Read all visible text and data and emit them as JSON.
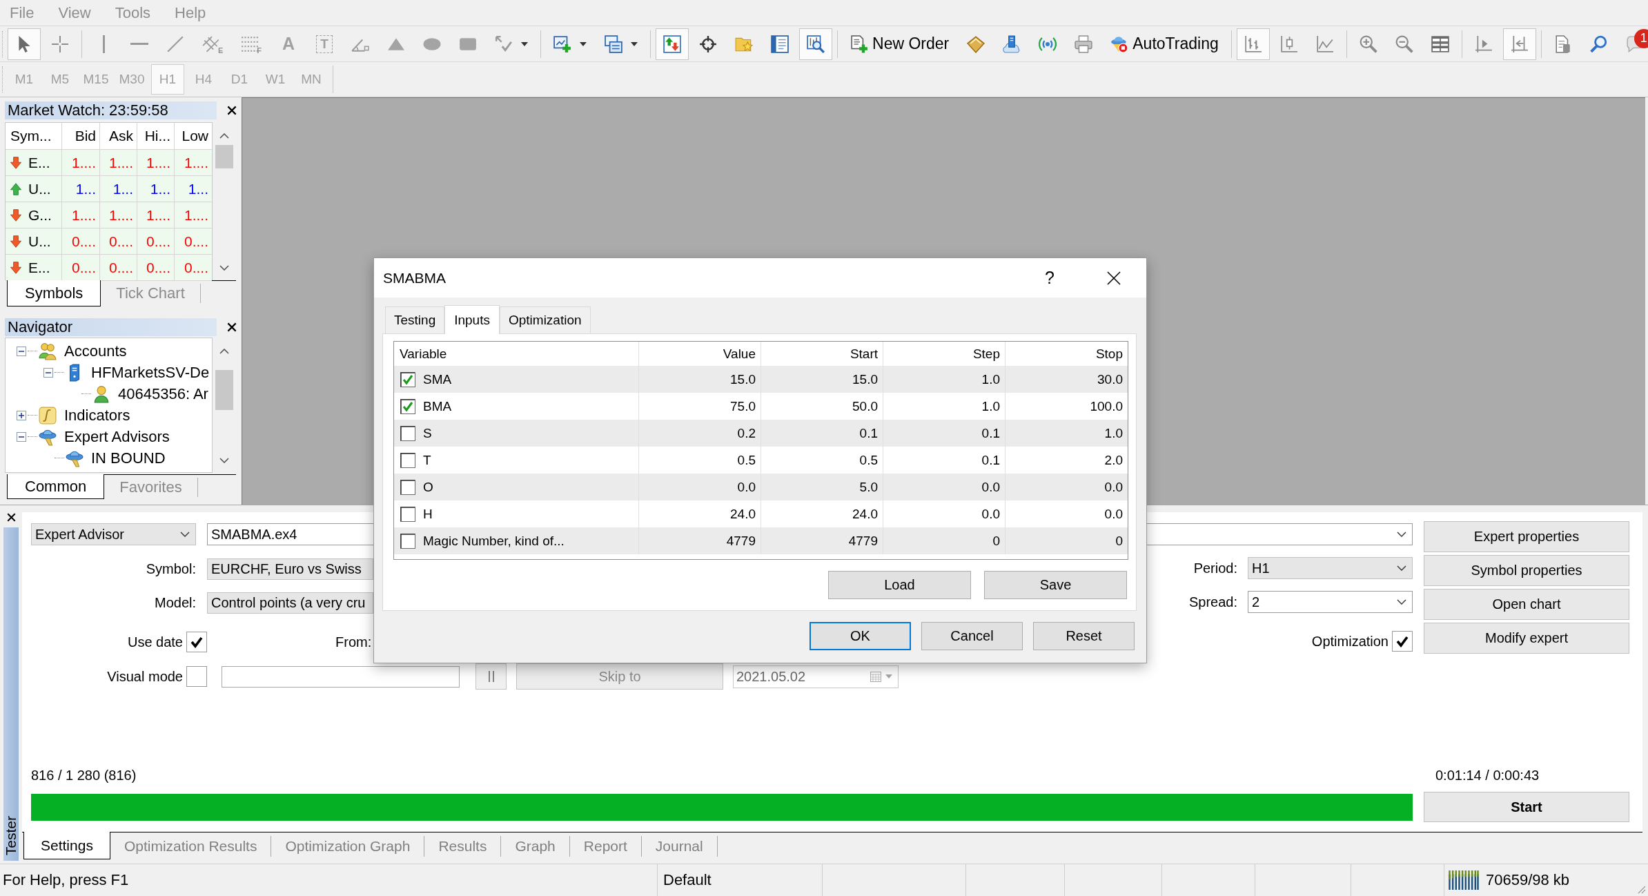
{
  "menu": [
    "File",
    "View",
    "Tools",
    "Help"
  ],
  "toolbar": {
    "groups": [
      [
        {
          "kind": "cursor",
          "pressed": true
        },
        {
          "kind": "crosshair",
          "pressed": false
        }
      ],
      [
        {
          "kind": "vertical-line",
          "pressed": false
        },
        {
          "kind": "horizontal-line",
          "pressed": false
        },
        {
          "kind": "trend-line",
          "pressed": false
        },
        {
          "kind": "channel",
          "glyph": "E",
          "pressed": false
        },
        {
          "kind": "fibonacci",
          "glyph": "F",
          "pressed": false
        },
        {
          "kind": "text",
          "glyph": "A",
          "pressed": false
        },
        {
          "kind": "label",
          "glyph": "T",
          "pressed": false
        },
        {
          "kind": "angle",
          "pressed": false
        },
        {
          "kind": "triangle",
          "pressed": false
        },
        {
          "kind": "ellipse",
          "pressed": false
        },
        {
          "kind": "rectangle",
          "pressed": false
        },
        {
          "kind": "arrows",
          "dropdown": true,
          "pressed": false
        }
      ],
      [
        {
          "kind": "new-chart",
          "dropdown": true,
          "pressed": false
        },
        {
          "kind": "profiles",
          "dropdown": true,
          "pressed": false
        }
      ],
      [
        {
          "kind": "market-watch",
          "pressed": true
        },
        {
          "kind": "data-window",
          "pressed": false
        },
        {
          "kind": "navigator",
          "pressed": false
        },
        {
          "kind": "terminal",
          "pressed": false
        },
        {
          "kind": "tester",
          "pressed": true
        }
      ],
      [
        {
          "kind": "new-order",
          "label": "New Order",
          "pressed": false
        },
        {
          "kind": "editor",
          "pressed": false
        },
        {
          "kind": "market",
          "pressed": false
        },
        {
          "kind": "signals",
          "pressed": false
        },
        {
          "kind": "print",
          "pressed": false
        },
        {
          "kind": "autotrading",
          "label": "AutoTrading",
          "pressed": false
        }
      ],
      [
        {
          "kind": "bar-chart",
          "pressed": true
        },
        {
          "kind": "candles",
          "pressed": false
        },
        {
          "kind": "line-chart",
          "pressed": false
        }
      ],
      [
        {
          "kind": "zoom-in",
          "pressed": false
        },
        {
          "kind": "zoom-out",
          "pressed": false
        },
        {
          "kind": "tile",
          "pressed": false
        }
      ],
      [
        {
          "kind": "chart-shift",
          "pressed": false
        },
        {
          "kind": "auto-scroll",
          "pressed": true
        }
      ],
      [
        {
          "kind": "templates",
          "pressed": false
        },
        {
          "kind": "search",
          "pressed": false
        },
        {
          "kind": "chat",
          "badge": "1",
          "pressed": false
        }
      ]
    ]
  },
  "timeframes": [
    {
      "label": "M1",
      "selected": false
    },
    {
      "label": "M5",
      "selected": false
    },
    {
      "label": "M15",
      "selected": false
    },
    {
      "label": "M30",
      "selected": false
    },
    {
      "label": "H1",
      "selected": true
    },
    {
      "label": "H4",
      "selected": false
    },
    {
      "label": "D1",
      "selected": false
    },
    {
      "label": "W1",
      "selected": false
    },
    {
      "label": "MN",
      "selected": false
    }
  ],
  "market_watch": {
    "title": "Market Watch: 23:59:58",
    "columns": [
      "Sym...",
      "Bid",
      "Ask",
      "Hi...",
      "Low"
    ],
    "rows": [
      {
        "kind": "down",
        "symbol": "E...",
        "bid": "1....",
        "ask": "1....",
        "high": "1....",
        "low": "1...."
      },
      {
        "kind": "up",
        "symbol": "U...",
        "bid": "1...",
        "ask": "1...",
        "high": "1...",
        "low": "1..."
      },
      {
        "kind": "down",
        "symbol": "G...",
        "bid": "1....",
        "ask": "1....",
        "high": "1....",
        "low": "1...."
      },
      {
        "kind": "down",
        "symbol": "U...",
        "bid": "0....",
        "ask": "0....",
        "high": "0....",
        "low": "0...."
      },
      {
        "kind": "down",
        "symbol": "E...",
        "bid": "0....",
        "ask": "0....",
        "high": "0....",
        "low": "0...."
      }
    ],
    "tabs": [
      {
        "label": "Symbols",
        "selected": true
      },
      {
        "label": "Tick Chart",
        "selected": false
      }
    ]
  },
  "navigator": {
    "title": "Navigator",
    "tree": [
      {
        "kind": "accounts",
        "label": "Accounts",
        "expanded": true,
        "children": [
          {
            "kind": "server",
            "label": "HFMarketsSV-De",
            "expanded": true,
            "children": [
              {
                "kind": "account",
                "label": "40645356: Ar"
              }
            ]
          }
        ]
      },
      {
        "kind": "indicators",
        "label": "Indicators",
        "expanded": false
      },
      {
        "kind": "experts",
        "label": "Expert Advisors",
        "expanded": true,
        "children": [
          {
            "kind": "expert",
            "label": "IN BOUND"
          }
        ]
      }
    ],
    "tabs": [
      {
        "label": "Common",
        "selected": true
      },
      {
        "label": "Favorites",
        "selected": false
      }
    ]
  },
  "tester": {
    "side_label": "Tester",
    "expert_type": {
      "kind": "list",
      "value": "Expert Advisor"
    },
    "expert_file": {
      "kind": "edit",
      "value": "SMABMA.ex4"
    },
    "fields": [
      {
        "label": "Symbol:",
        "kind": "list",
        "value": "EURCHF, Euro vs Swiss"
      },
      {
        "label": "Model:",
        "kind": "list",
        "value": "Control points (a very cru"
      }
    ],
    "use_date": {
      "label": "Use date",
      "checked": true
    },
    "from_label": "From:",
    "visual_mode": {
      "label": "Visual mode",
      "checked": false
    },
    "skip_to": {
      "label": "Skip to",
      "disabled": true
    },
    "date": {
      "value": "2021.05.02",
      "disabled": true
    },
    "period": {
      "label": "Period:",
      "kind": "list",
      "value": "H1"
    },
    "spread": {
      "label": "Spread:",
      "kind": "edit",
      "value": "2"
    },
    "optimization": {
      "label": "Optimization",
      "checked": true
    },
    "buttons": [
      "Expert properties",
      "Symbol properties",
      "Open chart",
      "Modify expert"
    ],
    "progress": {
      "count": "816 / 1 280 (816)",
      "level": 1,
      "elapsed": "0:01:14 / 0:00:43"
    },
    "start": "Start",
    "tabs": [
      {
        "label": "Settings",
        "selected": true
      },
      {
        "label": "Optimization Results",
        "selected": false
      },
      {
        "label": "Optimization Graph",
        "selected": false
      },
      {
        "label": "Results",
        "selected": false
      },
      {
        "label": "Graph",
        "selected": false
      },
      {
        "label": "Report",
        "selected": false
      },
      {
        "label": "Journal",
        "selected": false
      }
    ]
  },
  "status_bar": {
    "help": "For Help, press F1",
    "profile": "Default",
    "memory": "70659/98 kb"
  },
  "dialog": {
    "title": "SMABMA",
    "help": "?",
    "tabs": [
      {
        "label": "Testing",
        "selected": false
      },
      {
        "label": "Inputs",
        "selected": true
      },
      {
        "label": "Optimization",
        "selected": false
      }
    ],
    "columns": [
      "Variable",
      "Value",
      "Start",
      "Step",
      "Stop"
    ],
    "rows": [
      {
        "checked": true,
        "variable": "SMA",
        "value": "15.0",
        "start": "15.0",
        "step": "1.0",
        "stop": "30.0"
      },
      {
        "checked": true,
        "variable": "BMA",
        "value": "75.0",
        "start": "50.0",
        "step": "1.0",
        "stop": "100.0"
      },
      {
        "checked": false,
        "variable": "S",
        "value": "0.2",
        "start": "0.1",
        "step": "0.1",
        "stop": "1.0"
      },
      {
        "checked": false,
        "variable": "T",
        "value": "0.5",
        "start": "0.5",
        "step": "0.1",
        "stop": "2.0"
      },
      {
        "checked": false,
        "variable": "O",
        "value": "0.0",
        "start": "5.0",
        "step": "0.0",
        "stop": "0.0"
      },
      {
        "checked": false,
        "variable": "H",
        "value": "24.0",
        "start": "24.0",
        "step": "0.0",
        "stop": "0.0"
      },
      {
        "checked": false,
        "variable": "Magic Number, kind of...",
        "value": "4779",
        "start": "4779",
        "step": "0",
        "stop": "0"
      }
    ],
    "file_buttons": [
      "Load",
      "Save"
    ],
    "buttons": [
      {
        "label": "OK",
        "default": true
      },
      {
        "label": "Cancel",
        "default": false
      },
      {
        "label": "Reset",
        "default": false
      }
    ]
  }
}
